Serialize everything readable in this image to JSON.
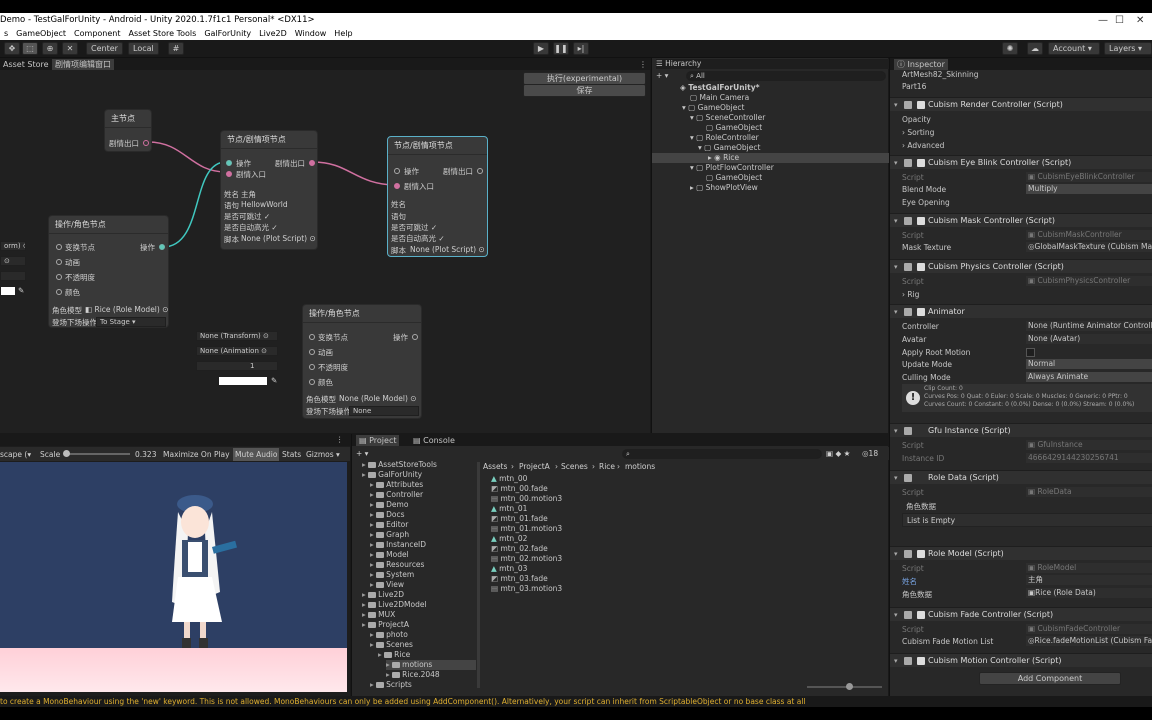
{
  "window": {
    "title": "Demo - TestGalForUnity - Android - Unity 2020.1.7f1c1 Personal* <DX11>"
  },
  "menu": [
    "s",
    "GameObject",
    "Component",
    "Asset Store Tools",
    "GalForUnity",
    "Live2D",
    "Window",
    "Help"
  ],
  "toolbar": {
    "center": "Center",
    "local": "Local",
    "account": "Account",
    "layers": "Layers"
  },
  "graph": {
    "tabs": [
      "Asset Store",
      "剧情项编辑窗口"
    ],
    "exec_button": "执行(experimental)",
    "save_button": "保存",
    "main_node": {
      "title": "主节点",
      "out": "剧情出口"
    },
    "plot_node_1": {
      "title": "节点/剧情项节点",
      "op": "操作",
      "entry": "剧情入口",
      "exit": "剧情出口",
      "name_label": "姓名",
      "name_value": "主角",
      "speech_label": "语句",
      "speech_value": "HellowWorld",
      "skippable": "是否可跳过",
      "autohl": "是否自动高光",
      "script_label": "脚本",
      "script_value": "None (Plot Script)"
    },
    "plot_node_2": {
      "title": "节点/剧情项节点",
      "op": "操作",
      "exit": "剧情出口",
      "entry": "剧情入口",
      "name_label": "姓名",
      "speech_label": "语句",
      "skippable": "是否可跳过",
      "autohl": "是否自动高光",
      "script_label": "脚本",
      "script_value": "None (Plot Script)"
    },
    "role_node_1": {
      "title": "操作/角色节点",
      "transform": "变换节点",
      "anim": "动画",
      "opacity": "不透明度",
      "color": "颜色",
      "op": "操作",
      "in_transform": "orm)",
      "model_label": "角色模型",
      "model_value": "Rice (Role Model)",
      "stage_label": "登场下场操作",
      "stage_value": "To Stage"
    },
    "role_node_2": {
      "title": "操作/角色节点",
      "transform": "变换节点",
      "anim": "动画",
      "opacity": "不透明度",
      "color": "颜色",
      "op": "操作",
      "in_transform": "None (Transform)",
      "in_anim": "None (Animation",
      "in_opacity": "1",
      "model_label": "角色模型",
      "model_value": "None (Role Model)",
      "stage_label": "登场下场操作",
      "stage_value": "None"
    }
  },
  "hierarchy": {
    "tab": "Hierarchy",
    "search_placeholder": "All",
    "items": [
      {
        "label": "TestGalForUnity*"
      },
      {
        "label": "Main Camera"
      },
      {
        "label": "GameObject"
      },
      {
        "label": "SceneController"
      },
      {
        "label": "GameObject"
      },
      {
        "label": "RoleController"
      },
      {
        "label": "GameObject"
      },
      {
        "label": "Rice"
      },
      {
        "label": "PlotFlowController"
      },
      {
        "label": "GameObject"
      },
      {
        "label": "ShowPlotView"
      }
    ]
  },
  "game": {
    "aspect": "scape (",
    "scale_label": "Scale",
    "scale_value": "0.323",
    "maximize": "Maximize On Play",
    "mute": "Mute Audio",
    "stats": "Stats",
    "gizmos": "Gizmos"
  },
  "project": {
    "tabs": [
      "Project",
      "Console"
    ],
    "count": "18",
    "breadcrumb": [
      "Assets",
      "ProjectA",
      "Scenes",
      "Rice",
      "motions"
    ],
    "tree": [
      {
        "label": "AssetStoreTools",
        "indent": 1
      },
      {
        "label": "GalForUnity",
        "indent": 1
      },
      {
        "label": "Attributes",
        "indent": 2
      },
      {
        "label": "Controller",
        "indent": 2
      },
      {
        "label": "Demo",
        "indent": 2
      },
      {
        "label": "Docs",
        "indent": 2
      },
      {
        "label": "Editor",
        "indent": 2
      },
      {
        "label": "Graph",
        "indent": 2
      },
      {
        "label": "InstanceID",
        "indent": 2
      },
      {
        "label": "Model",
        "indent": 2
      },
      {
        "label": "Resources",
        "indent": 2
      },
      {
        "label": "System",
        "indent": 2
      },
      {
        "label": "View",
        "indent": 2
      },
      {
        "label": "Live2D",
        "indent": 1
      },
      {
        "label": "Live2DModel",
        "indent": 1
      },
      {
        "label": "MUX",
        "indent": 1
      },
      {
        "label": "ProjectA",
        "indent": 1
      },
      {
        "label": "photo",
        "indent": 2
      },
      {
        "label": "Scenes",
        "indent": 2
      },
      {
        "label": "Rice",
        "indent": 3
      },
      {
        "label": "motions",
        "indent": 4
      },
      {
        "label": "Rice.2048",
        "indent": 4
      },
      {
        "label": "Scripts",
        "indent": 2
      }
    ],
    "files": [
      "mtn_00",
      "mtn_00.fade",
      "mtn_00.motion3",
      "mtn_01",
      "mtn_01.fade",
      "mtn_01.motion3",
      "mtn_02",
      "mtn_02.fade",
      "mtn_02.motion3",
      "mtn_03",
      "mtn_03.fade",
      "mtn_03.motion3"
    ]
  },
  "inspector": {
    "tab": "Inspector",
    "top_rows": [
      "ArtMesh82_Skinning",
      "Part16"
    ],
    "render_ctrl": {
      "title": "Cubism Render Controller (Script)",
      "rows": [
        "Opacity",
        "Sorting",
        "Advanced"
      ]
    },
    "eye_blink": {
      "title": "Cubism Eye Blink Controller (Script)",
      "script_label": "Script",
      "script_value": "CubismEyeBlinkController",
      "blend_label": "Blend Mode",
      "blend_value": "Multiply",
      "eye_label": "Eye Opening"
    },
    "mask": {
      "title": "Cubism Mask Controller (Script)",
      "script_label": "Script",
      "script_value": "CubismMaskController",
      "tex_label": "Mask Texture",
      "tex_value": "GlobalMaskTexture (Cubism Mas"
    },
    "physics": {
      "title": "Cubism Physics Controller (Script)",
      "script_label": "Script",
      "script_value": "CubismPhysicsController",
      "rig_label": "Rig"
    },
    "animator": {
      "title": "Animator",
      "rows": [
        {
          "label": "Controller",
          "value": "None (Runtime Animator Controller)"
        },
        {
          "label": "Avatar",
          "value": "None (Avatar)"
        },
        {
          "label": "Apply Root Motion",
          "value": ""
        },
        {
          "label": "Update Mode",
          "value": "Normal"
        },
        {
          "label": "Culling Mode",
          "value": "Always Animate"
        }
      ],
      "info": [
        "Clip Count: 0",
        "Curves Pos: 0 Quat: 0 Euler: 0 Scale: 0 Muscles: 0 Generic: 0 PPtr: 0",
        "Curves Count: 0 Constant: 0 (0.0%) Dense: 0 (0.0%) Stream: 0 (0.0%)"
      ]
    },
    "gfu": {
      "title": "Gfu Instance (Script)",
      "script_label": "Script",
      "script_value": "GfuInstance",
      "id_label": "Instance ID",
      "id_value": "4666429144230256741"
    },
    "role_data": {
      "title": "Role Data (Script)",
      "script_label": "Script",
      "script_value": "RoleData",
      "field_label": "角色数据",
      "empty": "List is Empty"
    },
    "role_model": {
      "title": "Role Model (Script)",
      "script_label": "Script",
      "script_value": "RoleModel",
      "name_label": "姓名",
      "name_value": "主角",
      "data_label": "角色数据",
      "data_value": "Rice (Role Data)"
    },
    "fade": {
      "title": "Cubism Fade Controller (Script)",
      "script_label": "Script",
      "script_value": "CubismFadeController",
      "list_label": "Cubism Fade Motion List",
      "list_value": "Rice.fadeMotionList (Cubism Fa"
    },
    "motion": {
      "title": "Cubism Motion Controller (Script)"
    },
    "add_component": "Add Component"
  },
  "status": {
    "message": "to create a MonoBehaviour using the 'new' keyword.  This is not allowed.  MonoBehaviours can only be added using AddComponent(). Alternatively, your script can inherit from ScriptableObject or no base class at all"
  }
}
